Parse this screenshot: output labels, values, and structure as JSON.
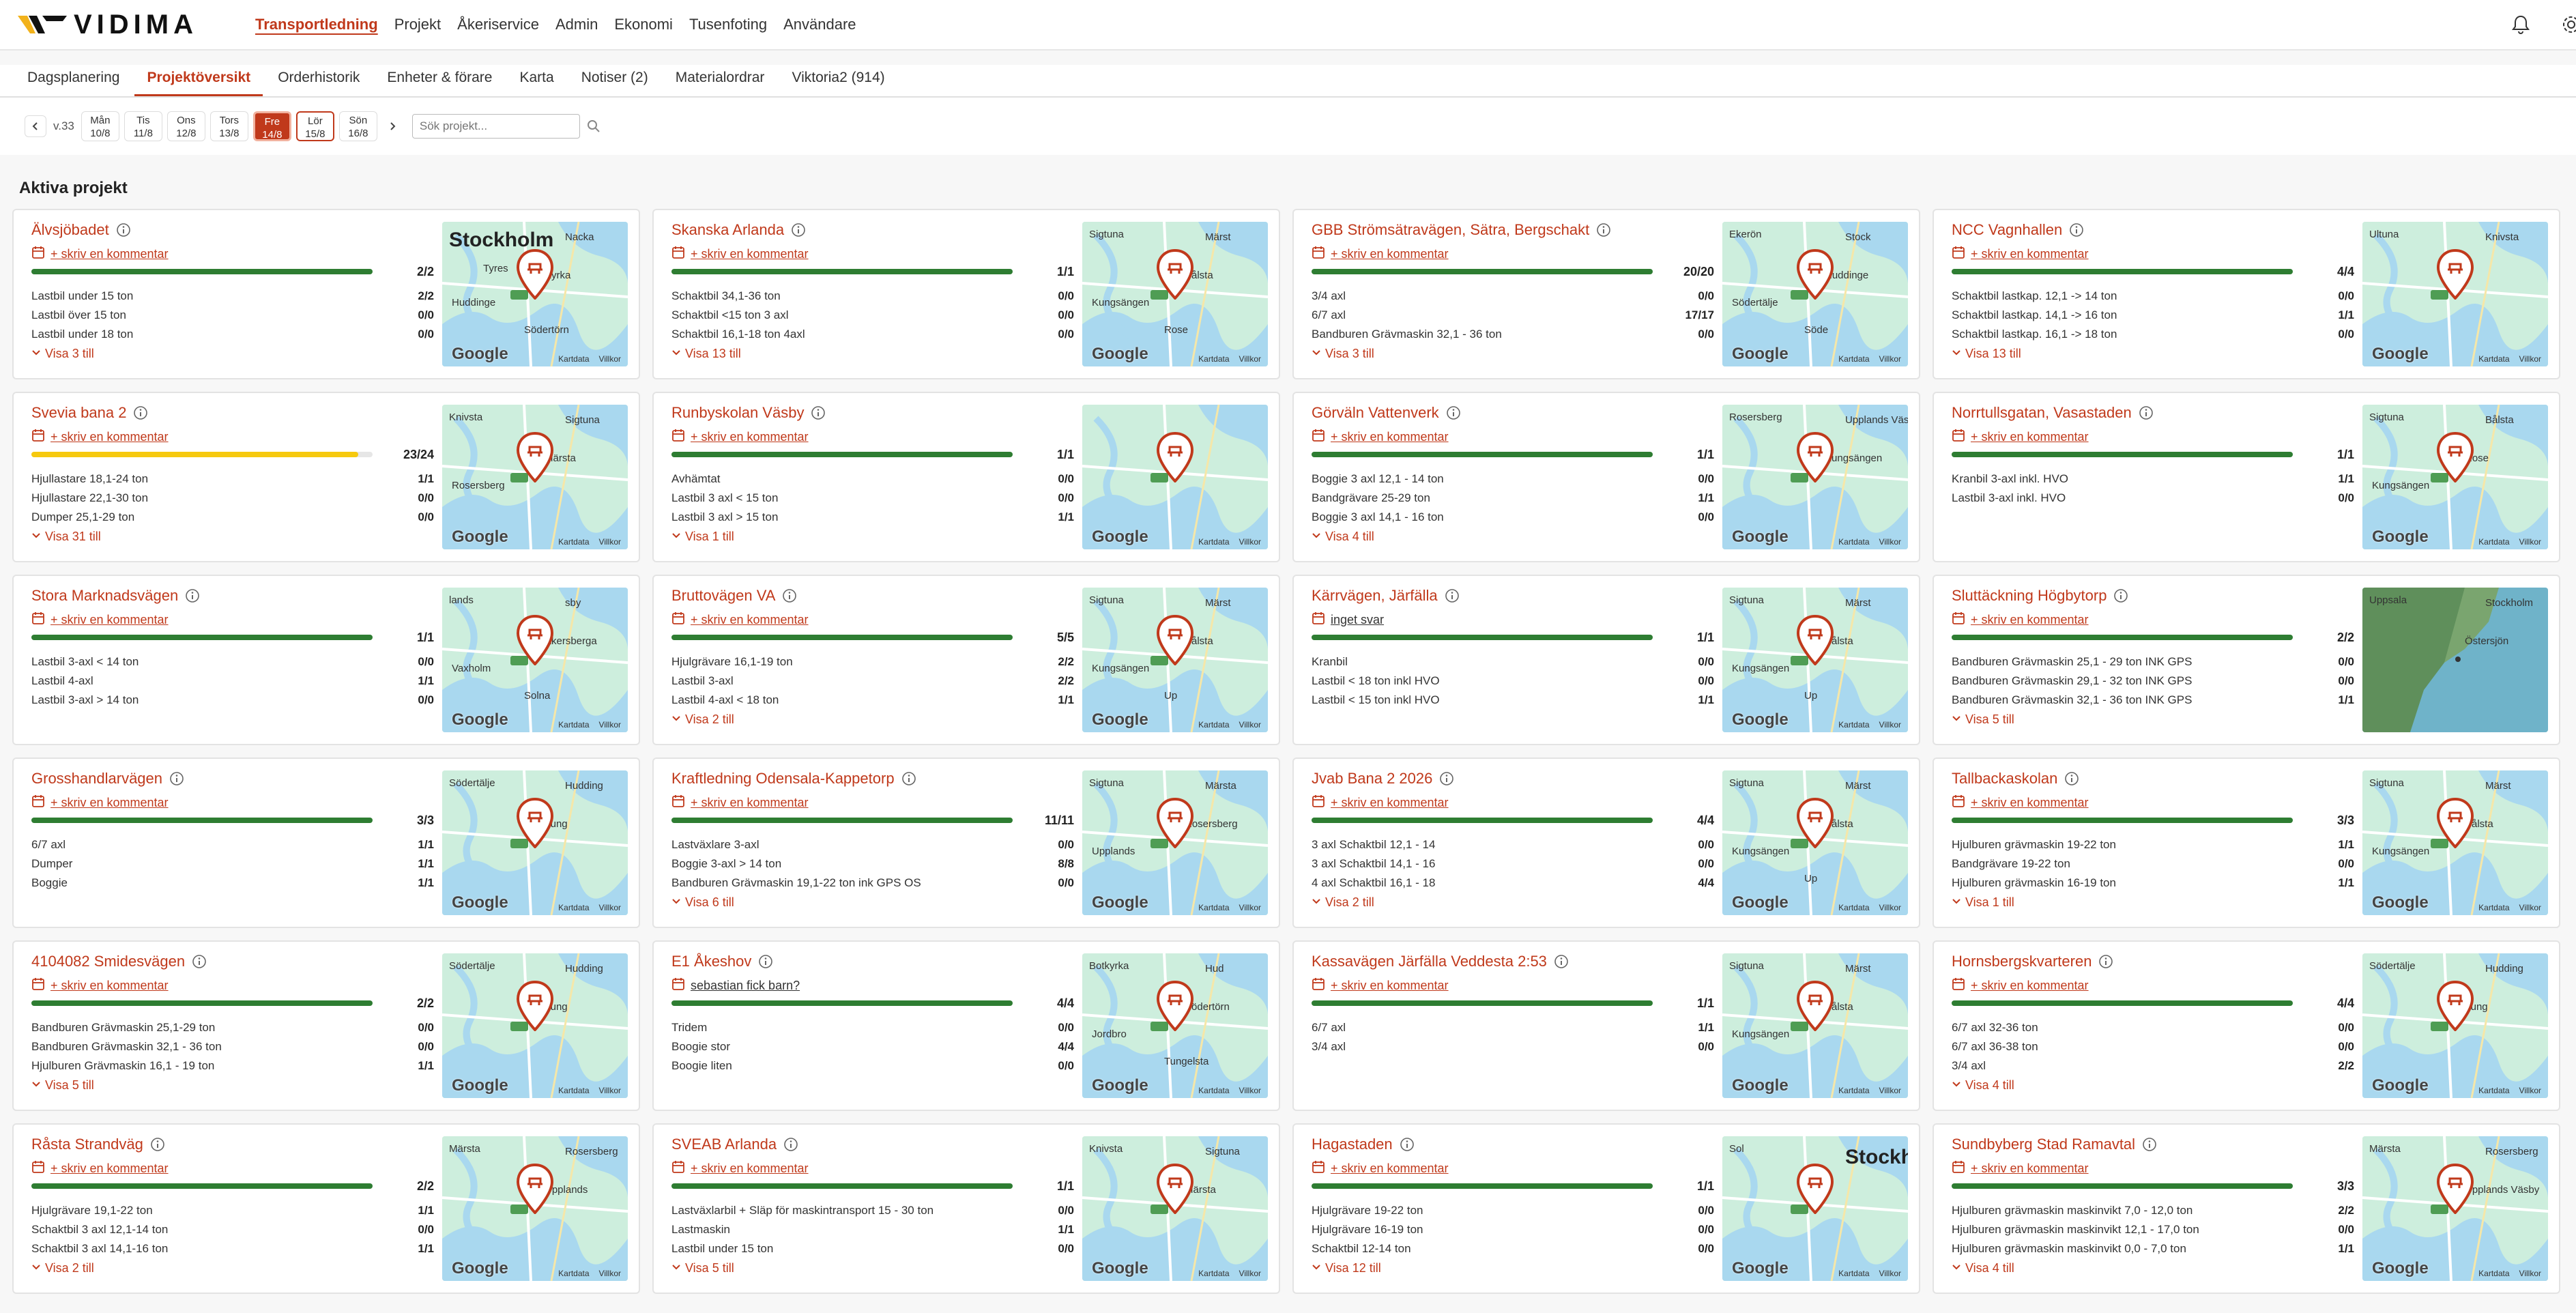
{
  "brand": {
    "name": "VIDIMA"
  },
  "nav": {
    "items": [
      {
        "label": "Transportledning",
        "active": true
      },
      {
        "label": "Projekt"
      },
      {
        "label": "Åkeriservice"
      },
      {
        "label": "Admin"
      },
      {
        "label": "Ekonomi"
      },
      {
        "label": "Tusenfoting"
      },
      {
        "label": "Användare"
      }
    ]
  },
  "subtabs": [
    {
      "label": "Dagsplanering"
    },
    {
      "label": "Projektöversikt",
      "active": true
    },
    {
      "label": "Orderhistorik"
    },
    {
      "label": "Enheter & förare"
    },
    {
      "label": "Karta"
    },
    {
      "label": "Notiser (2)"
    },
    {
      "label": "Materialordrar"
    },
    {
      "label": "Viktoria2 (914)"
    }
  ],
  "week": {
    "label": "v.33"
  },
  "days": [
    {
      "name": "Mån",
      "date": "10/8"
    },
    {
      "name": "Tis",
      "date": "11/8"
    },
    {
      "name": "Ons",
      "date": "12/8"
    },
    {
      "name": "Tors",
      "date": "13/8"
    },
    {
      "name": "Fre",
      "date": "14/8",
      "active": true
    },
    {
      "name": "Lör",
      "date": "15/8",
      "today": true
    },
    {
      "name": "Sön",
      "date": "16/8"
    }
  ],
  "search": {
    "placeholder": "Sök projekt..."
  },
  "section": {
    "title": "Aktiva projekt"
  },
  "map_common": {
    "google": "Google",
    "kartdata": "Kartdata",
    "villkor": "Villkor"
  },
  "colors": {
    "accent": "#c0391b",
    "bar_ok": "#2e7d32",
    "bar_partial": "#f6c90e"
  },
  "projects": [
    {
      "title": "Älvsjöbadet",
      "comment": "+ skriv en kommentar",
      "count": "2/2",
      "progress": 1.0,
      "rows": [
        [
          "Lastbil under 15 ton",
          "2/2"
        ],
        [
          "Lastbil över 15 ton",
          "0/0"
        ],
        [
          "Lastbil under 18 ton",
          "0/0"
        ]
      ],
      "more": "Visa 3 till",
      "map": {
        "labels": [
          "Stockholm",
          "Nacka",
          "Kyrka",
          "Huddinge",
          "Södertörn",
          "Tyres"
        ],
        "big": "Stockholm"
      }
    },
    {
      "title": "Skanska Arlanda",
      "comment": "+ skriv en kommentar",
      "count": "1/1",
      "progress": 1.0,
      "rows": [
        [
          "Schaktbil 34,1-36 ton",
          "0/0"
        ],
        [
          "Schaktbil <15 ton 3 axl",
          "0/0"
        ],
        [
          "Schaktbil 16,1-18 ton 4axl",
          "0/0"
        ]
      ],
      "more": "Visa 13 till",
      "map": {
        "labels": [
          "Sigtuna",
          "Märst",
          "Bålsta",
          "Kungsängen",
          "Rose"
        ]
      }
    },
    {
      "title": "GBB Strömsätravägen, Sätra, Bergschakt",
      "comment": "+ skriv en kommentar",
      "count": "20/20",
      "progress": 1.0,
      "rows": [
        [
          "3/4 axl",
          "0/0"
        ],
        [
          "6/7 axl",
          "17/17"
        ],
        [
          "Bandburen Grävmaskin 32,1 - 36 ton",
          "0/0"
        ]
      ],
      "more": "Visa 3 till",
      "map": {
        "labels": [
          "Ekerön",
          "Stock",
          "Huddinge",
          "Södertälje",
          "Söde"
        ]
      }
    },
    {
      "title": "NCC Vagnhallen",
      "comment": "+ skriv en kommentar",
      "count": "4/4",
      "progress": 1.0,
      "rows": [
        [
          "Schaktbil lastkap. 12,1 -> 14 ton",
          "0/0"
        ],
        [
          "Schaktbil lastkap. 14,1 -> 16 ton",
          "1/1"
        ],
        [
          "Schaktbil lastkap. 16,1 -> 18 ton",
          "0/0"
        ]
      ],
      "more": "Visa 13 till",
      "map": {
        "labels": [
          "Ultuna",
          "Knivsta"
        ]
      }
    },
    {
      "title": "Svevia bana 2",
      "comment": "+ skriv en kommentar",
      "count": "23/24",
      "progress": 0.958,
      "partial": true,
      "rows": [
        [
          "Hjullastare 18,1-24 ton",
          "1/1"
        ],
        [
          "Hjullastare 22,1-30 ton",
          "0/0"
        ],
        [
          "Dumper 25,1-29 ton",
          "0/0"
        ]
      ],
      "more": "Visa 31 till",
      "map": {
        "labels": [
          "Knivsta",
          "Sigtuna",
          "Märsta",
          "Rosersberg"
        ]
      }
    },
    {
      "title": "Runbyskolan Väsby",
      "comment": "+ skriv en kommentar",
      "count": "1/1",
      "progress": 1.0,
      "rows": [
        [
          "Avhämtat",
          "0/0"
        ],
        [
          "Lastbil 3 axl < 15 ton",
          "0/0"
        ],
        [
          "Lastbil 3 axl > 15 ton",
          "1/1"
        ]
      ],
      "more": "Visa 1 till",
      "map": {
        "labels": []
      }
    },
    {
      "title": "Görväln Vattenverk",
      "comment": "+ skriv en kommentar",
      "count": "1/1",
      "progress": 1.0,
      "rows": [
        [
          "Boggie 3 axl 12,1 - 14 ton",
          "0/0"
        ],
        [
          "Bandgrävare 25-29 ton",
          "1/1"
        ],
        [
          "Boggie 3 axl 14,1 - 16 ton",
          "0/0"
        ]
      ],
      "more": "Visa 4 till",
      "map": {
        "labels": [
          "Rosersberg",
          "Upplands Väsby",
          "Kungsängen"
        ]
      }
    },
    {
      "title": "Norrtullsgatan, Vasastaden",
      "comment": "+ skriv en kommentar",
      "count": "1/1",
      "progress": 1.0,
      "rows": [
        [
          "Kranbil 3-axl inkl. HVO",
          "1/1"
        ],
        [
          "Lastbil 3-axl inkl. HVO",
          "0/0"
        ]
      ],
      "more": "",
      "map": {
        "labels": [
          "Sigtuna",
          "Bålsta",
          "Rose",
          "Kungsängen"
        ]
      }
    },
    {
      "title": "Stora Marknadsvägen",
      "comment": "+ skriv en kommentar",
      "count": "1/1",
      "progress": 1.0,
      "rows": [
        [
          "Lastbil 3-axl < 14 ton",
          "0/0"
        ],
        [
          "Lastbil 4-axl",
          "1/1"
        ],
        [
          "Lastbil 3-axl > 14 ton",
          "0/0"
        ]
      ],
      "more": "",
      "map": {
        "labels": [
          "lands",
          "sby",
          "Åkersberga",
          "Vaxholm",
          "Solna"
        ]
      }
    },
    {
      "title": "Bruttovägen VA",
      "comment": "+ skriv en kommentar",
      "count": "5/5",
      "progress": 1.0,
      "rows": [
        [
          "Hjulgrävare 16,1-19 ton",
          "2/2"
        ],
        [
          "Lastbil 3-axl",
          "2/2"
        ],
        [
          "Lastbil 4-axl < 18 ton",
          "1/1"
        ]
      ],
      "more": "Visa 2 till",
      "map": {
        "labels": [
          "Sigtuna",
          "Märst",
          "Bålsta",
          "Kungsängen",
          "Up"
        ]
      }
    },
    {
      "title": "Kärrvägen, Järfälla",
      "comment": "inget svar",
      "note": true,
      "count": "1/1",
      "progress": 1.0,
      "rows": [
        [
          "Kranbil",
          "0/0"
        ],
        [
          "Lastbil < 18 ton inkl HVO",
          "0/0"
        ],
        [
          "Lastbil < 15 ton inkl HVO",
          "1/1"
        ]
      ],
      "more": "",
      "map": {
        "labels": [
          "Sigtuna",
          "Märst",
          "Bålsta",
          "Kungsängen",
          "Up"
        ]
      }
    },
    {
      "title": "Sluttäckning Högbytorp",
      "comment": "+ skriv en kommentar",
      "count": "2/2",
      "progress": 1.0,
      "rows": [
        [
          "Bandburen Grävmaskin 25,1 - 29 ton INK GPS",
          "0/0"
        ],
        [
          "Bandburen Grävmaskin 29,1 - 32 ton INK GPS",
          "0/0"
        ],
        [
          "Bandburen Grävmaskin 32,1 - 36 ton INK GPS",
          "1/1"
        ]
      ],
      "more": "Visa 5 till",
      "map": {
        "labels": [
          "Uppsala",
          "Stockholm",
          "Östersjön"
        ],
        "satellite": true
      }
    },
    {
      "title": "Grosshandlarvägen",
      "comment": "+ skriv en kommentar",
      "count": "3/3",
      "progress": 1.0,
      "rows": [
        [
          "6/7 axl",
          "1/1"
        ],
        [
          "Dumper",
          "1/1"
        ],
        [
          "Boggie",
          "1/1"
        ]
      ],
      "more": "",
      "map": {
        "labels": [
          "Södertälje",
          "Hudding",
          "Tung"
        ]
      }
    },
    {
      "title": "Kraftledning Odensala-Kappetorp",
      "comment": "+ skriv en kommentar",
      "count": "11/11",
      "progress": 1.0,
      "rows": [
        [
          "Lastväxlare 3-axl",
          "0/0"
        ],
        [
          "Boggie 3-axl > 14 ton",
          "8/8"
        ],
        [
          "Bandburen Grävmaskin 19,1-22 ton ink GPS OS",
          "0/0"
        ]
      ],
      "more": "Visa 6 till",
      "map": {
        "labels": [
          "Sigtuna",
          "Märsta",
          "Rosersberg",
          "Upplands"
        ]
      }
    },
    {
      "title": "Jvab Bana 2 2026",
      "comment": "+ skriv en kommentar",
      "count": "4/4",
      "progress": 1.0,
      "rows": [
        [
          "3 axl Schaktbil 12,1 - 14",
          "0/0"
        ],
        [
          "3 axl Schaktbil 14,1 - 16",
          "0/0"
        ],
        [
          "4 axl Schaktbil 16,1 - 18",
          "4/4"
        ]
      ],
      "more": "Visa 2 till",
      "map": {
        "labels": [
          "Sigtuna",
          "Märst",
          "Bålsta",
          "Kungsängen",
          "Up"
        ]
      }
    },
    {
      "title": "Tallbackaskolan",
      "comment": "+ skriv en kommentar",
      "count": "3/3",
      "progress": 1.0,
      "rows": [
        [
          "Hjulburen grävmaskin 19-22 ton",
          "1/1"
        ],
        [
          "Bandgrävare 19-22 ton",
          "0/0"
        ],
        [
          "Hjulburen grävmaskin 16-19 ton",
          "1/1"
        ]
      ],
      "more": "Visa 1 till",
      "map": {
        "labels": [
          "Sigtuna",
          "Märst",
          "Bålsta",
          "Kungsängen"
        ]
      }
    },
    {
      "title": "4104082 Smidesvägen",
      "comment": "+ skriv en kommentar",
      "count": "2/2",
      "progress": 1.0,
      "rows": [
        [
          "Bandburen Grävmaskin 25,1-29 ton",
          "0/0"
        ],
        [
          "Bandburen Grävmaskin 32,1 - 36 ton",
          "0/0"
        ],
        [
          "Hjulburen Grävmaskin 16,1 - 19 ton",
          "1/1"
        ]
      ],
      "more": "Visa 5 till",
      "map": {
        "labels": [
          "Södertälje",
          "Hudding",
          "Tung"
        ]
      }
    },
    {
      "title": "E1 Åkeshov",
      "comment": "sebastian fick barn?",
      "note": true,
      "count": "4/4",
      "progress": 1.0,
      "rows": [
        [
          "Tridem",
          "0/0"
        ],
        [
          "Boogie stor",
          "4/4"
        ],
        [
          "Boogie liten",
          "0/0"
        ]
      ],
      "more": "",
      "map": {
        "labels": [
          "Botkyrka",
          "Hud",
          "Södertörn",
          "Jordbro",
          "Tungelsta"
        ]
      }
    },
    {
      "title": "Kassavägen Järfälla Veddesta 2:53",
      "comment": "+ skriv en kommentar",
      "count": "1/1",
      "progress": 1.0,
      "rows": [
        [
          "6/7 axl",
          "1/1"
        ],
        [
          "3/4 axl",
          "0/0"
        ]
      ],
      "more": "",
      "map": {
        "labels": [
          "Sigtuna",
          "Märst",
          "Bålsta",
          "Kungsängen"
        ]
      }
    },
    {
      "title": "Hornsbergskvarteren",
      "comment": "+ skriv en kommentar",
      "count": "4/4",
      "progress": 1.0,
      "rows": [
        [
          "6/7 axl 32-36 ton",
          "0/0"
        ],
        [
          "6/7 axl 36-38 ton",
          "0/0"
        ],
        [
          "3/4 axl",
          "2/2"
        ]
      ],
      "more": "Visa 4 till",
      "map": {
        "labels": [
          "Södertälje",
          "Hudding",
          "Tung"
        ]
      }
    },
    {
      "title": "Råsta Strandväg",
      "comment": "+ skriv en kommentar",
      "count": "2/2",
      "progress": 1.0,
      "rows": [
        [
          "Hjulgrävare 19,1-22 ton",
          "1/1"
        ],
        [
          "Schaktbil 3 axl 12,1-14 ton",
          "0/0"
        ],
        [
          "Schaktbil 3 axl 14,1-16 ton",
          "1/1"
        ]
      ],
      "more": "Visa 2 till",
      "map": {
        "labels": [
          "Märsta",
          "Rosersberg",
          "Upplands"
        ]
      }
    },
    {
      "title": "SVEAB Arlanda",
      "comment": "+ skriv en kommentar",
      "count": "1/1",
      "progress": 1.0,
      "rows": [
        [
          "Lastväxlarbil + Släp för maskintransport 15 - 30 ton",
          "0/0"
        ],
        [
          "Lastmaskin",
          "1/1"
        ],
        [
          "Lastbil under 15 ton",
          "0/0"
        ]
      ],
      "more": "Visa 5 till",
      "map": {
        "labels": [
          "Knivsta",
          "Sigtuna",
          "Märsta"
        ]
      }
    },
    {
      "title": "Hagastaden",
      "comment": "+ skriv en kommentar",
      "count": "1/1",
      "progress": 1.0,
      "rows": [
        [
          "Hjulgrävare 19-22 ton",
          "0/0"
        ],
        [
          "Hjulgrävare 16-19 ton",
          "0/0"
        ],
        [
          "Schaktbil 12-14 ton",
          "0/0"
        ]
      ],
      "more": "Visa 12 till",
      "map": {
        "labels": [
          "Sol",
          "Stockholm"
        ],
        "big": "Stockholm"
      }
    },
    {
      "title": "Sundbyberg Stad Ramavtal",
      "comment": "+ skriv en kommentar",
      "count": "3/3",
      "progress": 1.0,
      "rows": [
        [
          "Hjulburen grävmaskin maskinvikt 7,0 - 12,0 ton",
          "2/2"
        ],
        [
          "Hjulburen grävmaskin maskinvikt 12,1 - 17,0 ton",
          "0/0"
        ],
        [
          "Hjulburen grävmaskin maskinvikt 0,0 - 7,0 ton",
          "1/1"
        ]
      ],
      "more": "Visa 4 till",
      "map": {
        "labels": [
          "Märsta",
          "Rosersberg",
          "Upplands Väsby"
        ]
      }
    }
  ]
}
